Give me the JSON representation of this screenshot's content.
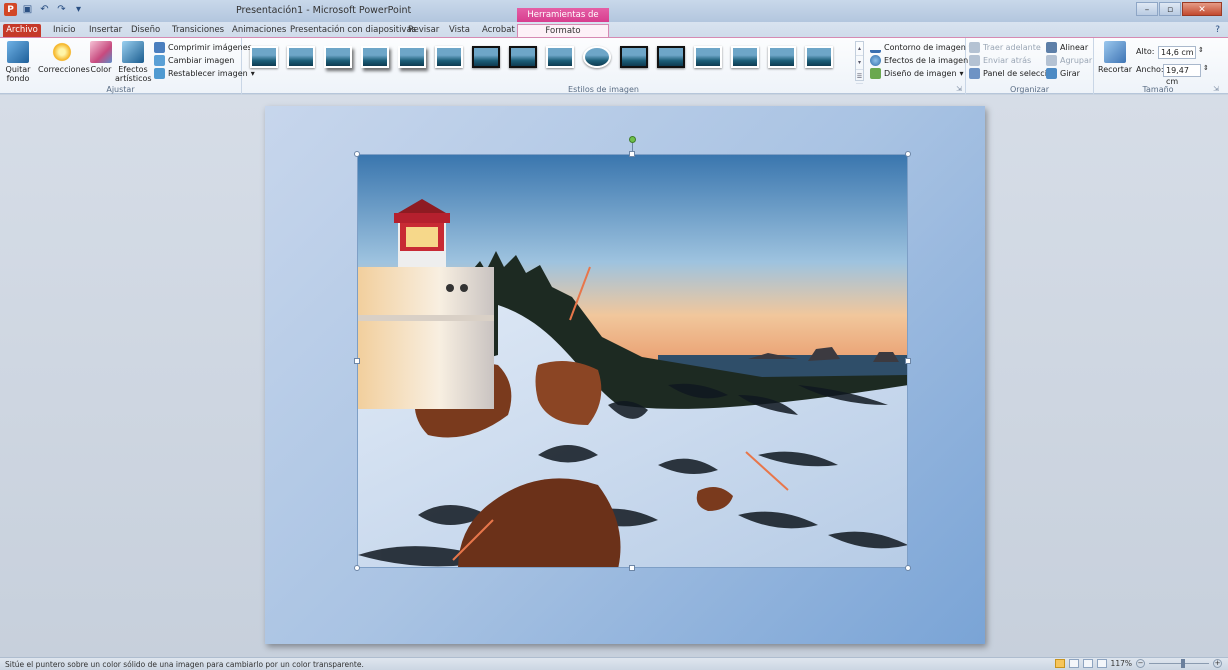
{
  "window": {
    "title": "Presentación1 - Microsoft PowerPoint",
    "contextual_header": "Herramientas de imagen",
    "app_icon": "P"
  },
  "tabs": [
    "Archivo",
    "Inicio",
    "Insertar",
    "Diseño",
    "Transiciones",
    "Animaciones",
    "Presentación con diapositivas",
    "Revisar",
    "Vista",
    "Acrobat",
    "Formato"
  ],
  "ribbon": {
    "ajustar": {
      "label": "Ajustar",
      "quitar_fondo": "Quitar fondo",
      "correcciones": "Correcciones",
      "color": "Color",
      "efectos": "Efectos artísticos",
      "comprimir": "Comprimir imágenes",
      "cambiar": "Cambiar imagen",
      "restablecer": "Restablecer imagen"
    },
    "estilos": {
      "label": "Estilos de imagen",
      "contorno": "Contorno de imagen",
      "efectos": "Efectos de la imagen",
      "diseno": "Diseño de imagen"
    },
    "organizar": {
      "label": "Organizar",
      "traer": "Traer adelante",
      "enviar": "Enviar atrás",
      "panel": "Panel de selección",
      "alinear": "Alinear",
      "agrupar": "Agrupar",
      "girar": "Girar"
    },
    "tamano": {
      "label": "Tamaño",
      "recortar": "Recortar",
      "alto_label": "Alto:",
      "alto_value": "14,6 cm",
      "ancho_label": "Ancho:",
      "ancho_value": "19,47 cm"
    }
  },
  "status": {
    "message": "Sitúe el puntero sobre un color sólido de una imagen para cambiarlo por un color transparente.",
    "zoom": "117%"
  },
  "colors": {
    "file_tab": "#c53929",
    "context_tab": "#d83d8e",
    "slide_bg": "#a9c3e3",
    "arrow": "#e8764a"
  }
}
